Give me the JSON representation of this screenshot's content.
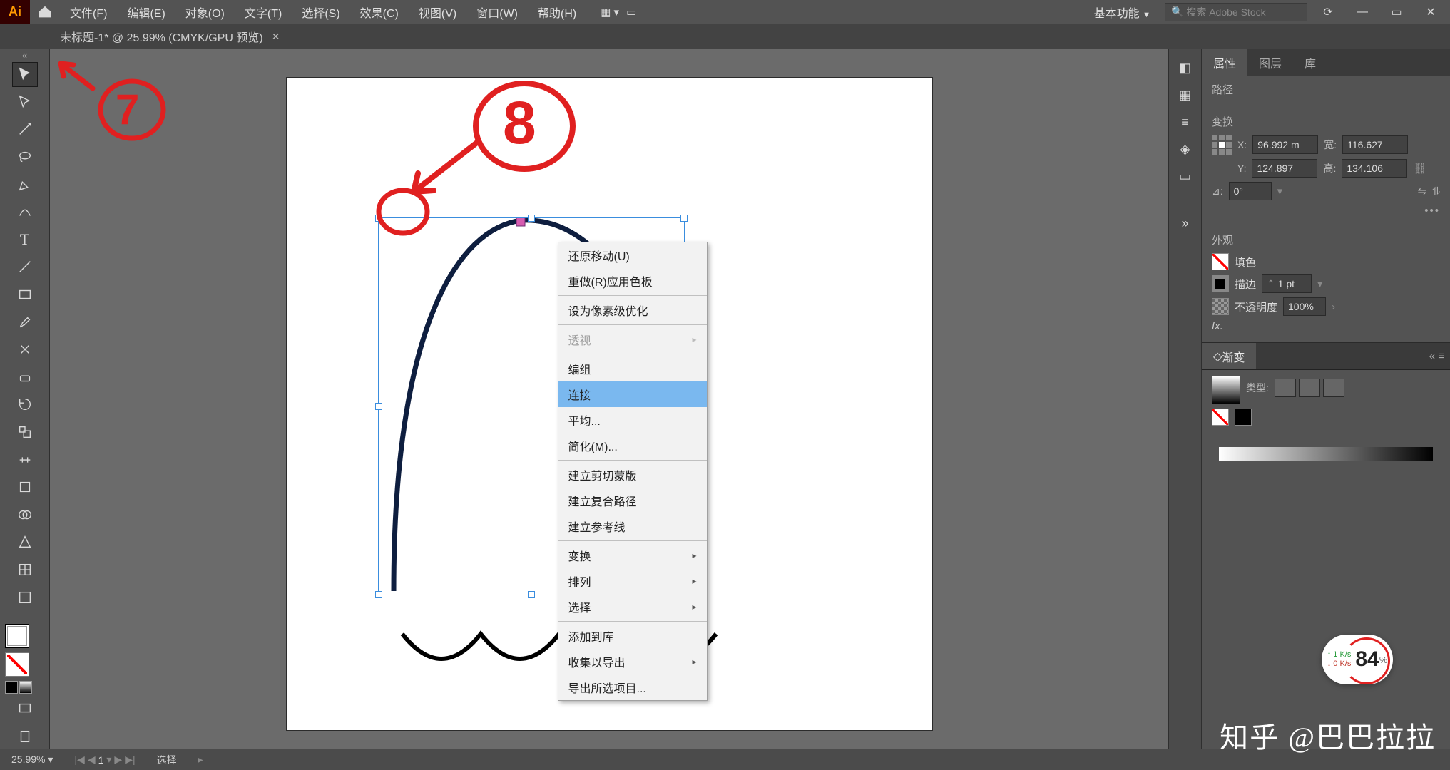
{
  "app": {
    "badge": "Ai"
  },
  "menu": {
    "items": [
      {
        "label": "文件(F)"
      },
      {
        "label": "编辑(E)"
      },
      {
        "label": "对象(O)"
      },
      {
        "label": "文字(T)"
      },
      {
        "label": "选择(S)"
      },
      {
        "label": "效果(C)"
      },
      {
        "label": "视图(V)"
      },
      {
        "label": "窗口(W)"
      },
      {
        "label": "帮助(H)"
      }
    ]
  },
  "workspace": {
    "label": "基本功能"
  },
  "search": {
    "placeholder": "搜索 Adobe Stock"
  },
  "doc_tab": {
    "title": "未标题-1* @ 25.99% (CMYK/GPU 预览)"
  },
  "context_menu": {
    "items": [
      {
        "label": "还原移动(U)",
        "disabled": false,
        "submenu": false
      },
      {
        "label": "重做(R)应用色板",
        "disabled": false,
        "submenu": false
      },
      {
        "label": "设为像素级优化",
        "disabled": false,
        "submenu": false
      },
      {
        "label": "透视",
        "disabled": true,
        "submenu": true,
        "sep_after": false
      },
      {
        "label": "编组",
        "disabled": false,
        "submenu": false
      },
      {
        "label": "连接",
        "disabled": false,
        "submenu": false,
        "highlight": true
      },
      {
        "label": "平均...",
        "disabled": false,
        "submenu": false
      },
      {
        "label": "简化(M)...",
        "disabled": false,
        "submenu": false
      },
      {
        "label": "建立剪切蒙版",
        "disabled": false,
        "submenu": false
      },
      {
        "label": "建立复合路径",
        "disabled": false,
        "submenu": false
      },
      {
        "label": "建立参考线",
        "disabled": false,
        "submenu": false
      },
      {
        "label": "变换",
        "disabled": false,
        "submenu": true
      },
      {
        "label": "排列",
        "disabled": false,
        "submenu": true
      },
      {
        "label": "选择",
        "disabled": false,
        "submenu": true
      },
      {
        "label": "添加到库",
        "disabled": false,
        "submenu": false
      },
      {
        "label": "收集以导出",
        "disabled": false,
        "submenu": true
      },
      {
        "label": "导出所选项目...",
        "disabled": false,
        "submenu": false
      }
    ]
  },
  "tools": [
    "selection",
    "direct-selection",
    "magic-wand",
    "lasso",
    "pen",
    "curvature",
    "type",
    "line",
    "rectangle",
    "brush",
    "shaper",
    "eraser",
    "rotate",
    "scale",
    "width",
    "free-transform",
    "shape-builder",
    "perspective",
    "mesh",
    "gradient",
    "eyedropper",
    "blend",
    "symbol-sprayer",
    "column-graph",
    "artboard",
    "slice",
    "hand",
    "zoom"
  ],
  "props": {
    "tabs": [
      "属性",
      "图层",
      "库"
    ],
    "section": "路径",
    "transform_label": "变换",
    "x": "96.992",
    "x_unit": "m",
    "y": "124.897",
    "w_label": "宽:",
    "w": "116.627",
    "h_label": "高:",
    "h": "134.106",
    "angle_label": "⊿:",
    "angle": "0°",
    "appearance_label": "外观",
    "fill_label": "填色",
    "stroke_label": "描边",
    "stroke_weight": "1 pt",
    "opacity_label": "不透明度",
    "opacity": "100%",
    "fx_label": "fx."
  },
  "gradient": {
    "tab": "渐变",
    "type_label": "类型:"
  },
  "status": {
    "zoom": "25.99%",
    "page": "1",
    "tool": "选择"
  },
  "net_badge": {
    "up": "↑ 1 K/s",
    "down": "↓ 0 K/s",
    "pct": "84",
    "pct_suffix": "%"
  },
  "watermark": "知乎 @巴巴拉拉",
  "annotations": {
    "seven": "7",
    "eight": "8"
  }
}
